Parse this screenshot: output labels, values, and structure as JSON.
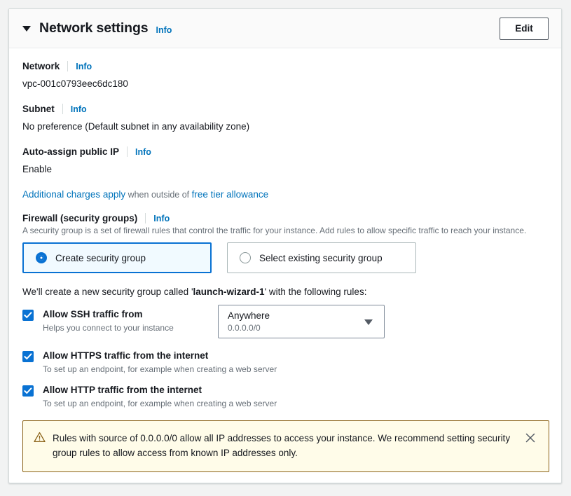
{
  "header": {
    "title": "Network settings",
    "info_label": "Info",
    "edit_label": "Edit",
    "caret_icon": "caret-down-icon"
  },
  "fields": {
    "network": {
      "label": "Network",
      "info_label": "Info",
      "value": "vpc-001c0793eec6dc180"
    },
    "subnet": {
      "label": "Subnet",
      "info_label": "Info",
      "value": "No preference (Default subnet in any availability zone)"
    },
    "auto_assign_public_ip": {
      "label": "Auto-assign public IP",
      "info_label": "Info",
      "value": "Enable",
      "charges_link": "Additional charges apply",
      "charges_middle": " when outside of ",
      "charges_link2": "free tier allowance"
    }
  },
  "firewall": {
    "label": "Firewall (security groups)",
    "info_label": "Info",
    "description": "A security group is a set of firewall rules that control the traffic for your instance. Add rules to allow specific traffic to reach your instance.",
    "options": [
      {
        "label": "Create security group",
        "selected": true
      },
      {
        "label": "Select existing security group",
        "selected": false
      }
    ],
    "sg_name_prefix": "We'll create a new security group called '",
    "sg_name": "launch-wizard-1",
    "sg_name_suffix": "' with the following rules:",
    "rules": [
      {
        "label": "Allow SSH traffic from",
        "help": "Helps you connect to your instance",
        "checked": true,
        "source_value": "Anywhere",
        "source_cidr": "0.0.0.0/0"
      },
      {
        "label": "Allow HTTPS traffic from the internet",
        "help": "To set up an endpoint, for example when creating a web server",
        "checked": true
      },
      {
        "label": "Allow HTTP traffic from the internet",
        "help": "To set up an endpoint, for example when creating a web server",
        "checked": true
      }
    ]
  },
  "alert": {
    "icon": "warning-triangle-icon",
    "message": "Rules with source of 0.0.0.0/0 allow all IP addresses to access your instance. We recommend setting security group rules to allow access from known IP addresses only.",
    "close_icon": "close-icon"
  },
  "colors": {
    "accent_blue": "#0972d3",
    "link_blue": "#0073bb",
    "warning_border": "#8a6116",
    "warning_bg": "#fffce9",
    "text_primary": "#16191f",
    "text_muted": "#687078"
  }
}
